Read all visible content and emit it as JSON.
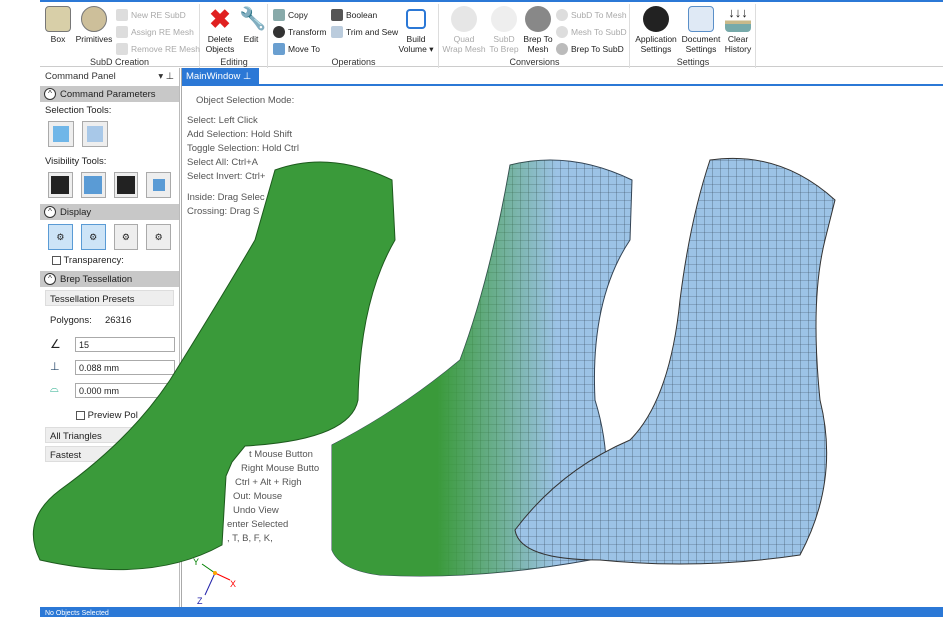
{
  "ribbon": {
    "subd": {
      "label": "SubD Creation",
      "box": "Box",
      "primitives": "Primitives",
      "new_re_subd": "New RE SubD",
      "assign_re_mesh": "Assign RE Mesh",
      "remove_re_mesh": "Remove RE Mesh"
    },
    "editing": {
      "label": "Editing",
      "delete1": "Delete",
      "delete2": "Objects",
      "edit": "Edit"
    },
    "operations": {
      "label": "Operations",
      "copy": "Copy",
      "transform": "Transform",
      "move_to": "Move To",
      "boolean": "Boolean",
      "trim_sew": "Trim and Sew",
      "build1": "Build",
      "build2": "Volume ▾"
    },
    "conversions": {
      "label": "Conversions",
      "quad1": "Quad",
      "quad2": "Wrap Mesh",
      "subd1": "SubD",
      "subd2": "To Brep",
      "brep1": "Brep To",
      "brep2": "Mesh",
      "subd_to_mesh": "SubD To Mesh",
      "mesh_to_subd": "Mesh To SubD",
      "brep_to_subd": "Brep To SubD"
    },
    "settings": {
      "label": "Settings",
      "app1": "Application",
      "app2": "Settings",
      "doc1": "Document",
      "doc2": "Settings",
      "clear1": "Clear",
      "clear2": "History"
    }
  },
  "panel": {
    "title": "Command Panel",
    "command_parameters": "Command Parameters",
    "selection_tools": "Selection Tools:",
    "visibility_tools": "Visibility Tools:",
    "display": "Display",
    "transparency": "Transparency:",
    "brep_tessellation": "Brep Tessellation",
    "tessellation_presets": "Tessellation Presets",
    "polygons_label": "Polygons:",
    "polygons_value": "26316",
    "angle_value": "15",
    "tolerance_value": "0.088 mm",
    "edge_value": "0.000 mm",
    "preview": "Preview Pol",
    "mesh_type": "All Triangles",
    "speed": "Fastest"
  },
  "viewport": {
    "tab": "MainWindow",
    "lines": [
      "Object Selection Mode:",
      "Select: Left Click",
      "Add Selection: Hold Shift",
      "Toggle Selection: Hold Ctrl",
      "Select All: Ctrl+A",
      "Select Invert: Ctrl+",
      "Inside: Drag Selec",
      "Crossing: Drag S"
    ],
    "lower_lines": [
      "t Mouse Button",
      "Right Mouse Butto",
      "Ctrl + Alt + Righ",
      "Out: Mouse",
      "Undo View",
      "enter Selected",
      ", T, B, F, K,"
    ],
    "axes": {
      "x": "X",
      "y": "Y",
      "z": "Z"
    }
  },
  "status": "No Objects Selected",
  "colors": {
    "accent": "#2b78d6",
    "foot_green": "#3a9a3a",
    "mesh_blue": "#9cc3e6"
  }
}
